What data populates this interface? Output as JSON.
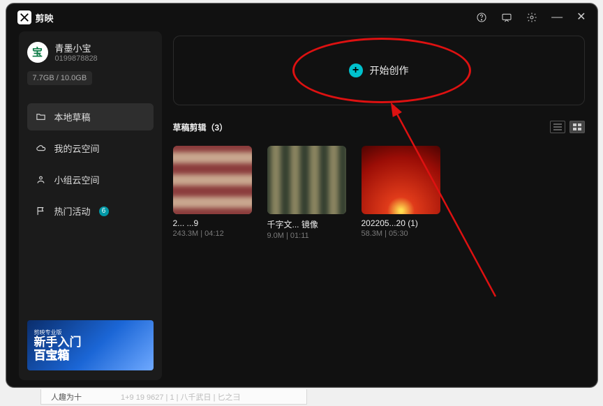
{
  "app": {
    "name": "剪映",
    "logo_glyph": "✂"
  },
  "titlebar": {
    "close": "✕",
    "minimize": "—"
  },
  "profile": {
    "avatar_glyph": "宝",
    "username": "青墨小宝",
    "user_id": "0199878828"
  },
  "storage": {
    "text": "7.7GB / 10.0GB"
  },
  "sidebar": {
    "items": [
      {
        "label": "本地草稿",
        "icon": "folder-icon",
        "active": true
      },
      {
        "label": "我的云空间",
        "icon": "cloud-icon"
      },
      {
        "label": "小组云空间",
        "icon": "group-icon"
      },
      {
        "label": "热门活动",
        "icon": "flag-icon",
        "badge": "6"
      }
    ],
    "banner": {
      "tag": "剪映专业版",
      "line1": "新手入门",
      "line2": "百宝箱"
    }
  },
  "main": {
    "create_label": "开始创作",
    "section_title": "草稿剪辑（3）",
    "drafts": [
      {
        "title": "2...      ...9",
        "meta": "243.3M | 04:12"
      },
      {
        "title": "千字文... 镜像",
        "meta": "9.0M | 01:11"
      },
      {
        "title": "202205...20 (1)",
        "meta": "58.3M | 05:30"
      }
    ]
  },
  "footer": {
    "left": "人趣为十",
    "right": "1+9 19 9627 | 1 | 八千武日 | 匕之彐"
  }
}
